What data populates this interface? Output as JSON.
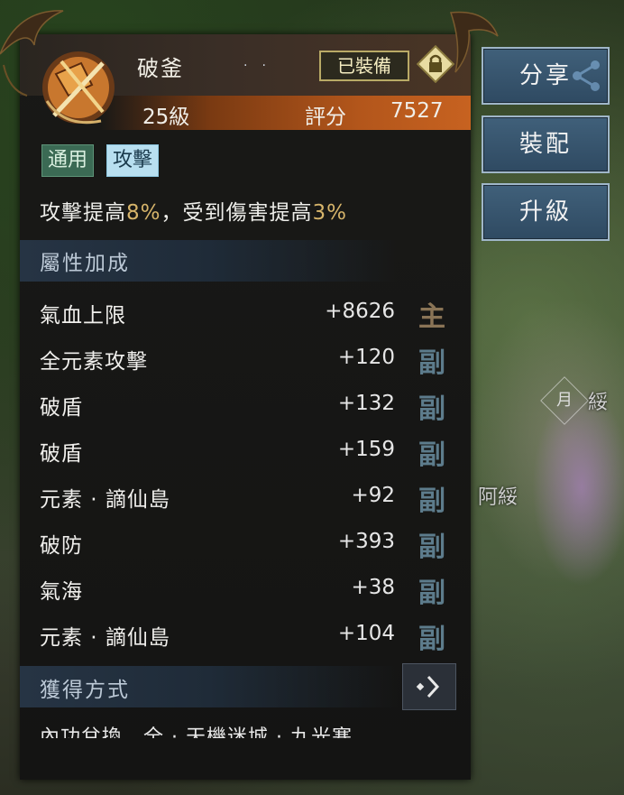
{
  "item": {
    "name": "破釜",
    "level": "25級",
    "rating_label": "評分",
    "rating_value": "7527",
    "equipped_label": "已裝備",
    "tags": [
      "通用",
      "攻擊"
    ],
    "description": {
      "part1": "攻擊提高",
      "value1": "8%",
      "part2": "，受到傷害提高",
      "value2": "3%"
    }
  },
  "attributes": {
    "title": "屬性加成",
    "rows": [
      {
        "name": "氣血上限",
        "value": "+8626",
        "kind": "主"
      },
      {
        "name": "全元素攻擊",
        "value": "+120",
        "kind": "副"
      },
      {
        "name": "破盾",
        "value": "+132",
        "kind": "副"
      },
      {
        "name": "破盾",
        "value": "+159",
        "kind": "副"
      },
      {
        "name": "元素 · 謫仙島",
        "value": "+92",
        "kind": "副"
      },
      {
        "name": "破防",
        "value": "+393",
        "kind": "副"
      },
      {
        "name": "氣海",
        "value": "+38",
        "kind": "副"
      },
      {
        "name": "元素 · 謫仙島",
        "value": "+104",
        "kind": "副"
      }
    ]
  },
  "acquisition": {
    "title": "獲得方式",
    "text": "內功兌換，全 · 天機迷城 · 九光寒"
  },
  "side_buttons": [
    "分享",
    "裝配",
    "升級"
  ],
  "scene": {
    "moon_tag": "月",
    "npc_name": "阿綏",
    "npc_name_partial": "綏"
  },
  "colors": {
    "highlight": "#d6b46a",
    "tag_general": "#3b6a54",
    "tag_attack": "#b8dff0",
    "rating_band": "#b3561b"
  },
  "icons": [
    "axe-sword-icon",
    "lock-icon",
    "share-nodes-icon",
    "chevron-right-icon"
  ]
}
